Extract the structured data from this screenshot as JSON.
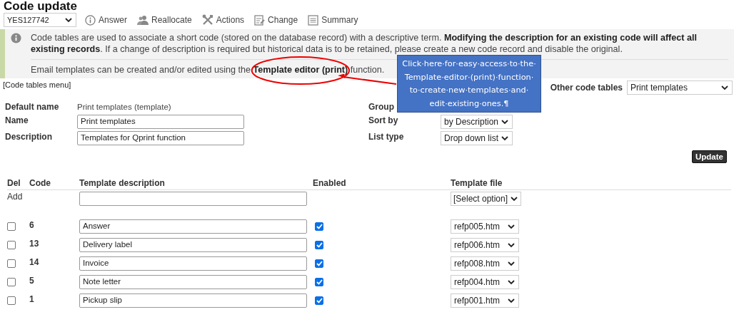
{
  "title": "Code update",
  "record_select": {
    "value": "YES127742"
  },
  "toolbar": [
    {
      "label": "Answer"
    },
    {
      "label": "Reallocate"
    },
    {
      "label": "Actions"
    },
    {
      "label": "Change"
    },
    {
      "label": "Summary"
    }
  ],
  "info": {
    "paragraphs": [
      "Code tables are used to associate a short code (stored on the database record) with a descriptive term. **Modifying the description for an existing code will affect all existing records**. If a change of description is required but historical data is to be retained, please create a new code record and disable the original.",
      "Email templates can be created and/or edited using the **Template editor (print)** function."
    ]
  },
  "code_tables_menu": "[Code tables menu]",
  "other_code_tables": {
    "label": "Other code tables",
    "value": "Print templates"
  },
  "form": {
    "left": [
      {
        "label": "Default name",
        "kind": "text",
        "value": "Print templates (template)"
      },
      {
        "label": "Name",
        "kind": "input",
        "value": "Print templates"
      },
      {
        "label": "Description",
        "kind": "input",
        "value": "Templates for Qprint function"
      }
    ],
    "right": [
      {
        "label": "Group",
        "kind": "none"
      },
      {
        "label": "Sort by",
        "kind": "select",
        "value": "by Description"
      },
      {
        "label": "List type",
        "kind": "select",
        "value": "Drop down list"
      }
    ]
  },
  "update_button": "Update",
  "table": {
    "columns": [
      "Del",
      "Code",
      "Template description",
      "Enabled",
      "Template file"
    ],
    "add_row": {
      "label": "Add",
      "file": "[Select option]"
    },
    "rows": [
      {
        "delete": false,
        "code": "6",
        "description": "Answer",
        "enabled": true,
        "file": "refp005.htm"
      },
      {
        "delete": false,
        "code": "13",
        "description": "Delivery label",
        "enabled": true,
        "file": "refp006.htm"
      },
      {
        "delete": false,
        "code": "14",
        "description": "Invoice",
        "enabled": true,
        "file": "refp008.htm"
      },
      {
        "delete": false,
        "code": "5",
        "description": "Note letter",
        "enabled": true,
        "file": "refp004.htm"
      },
      {
        "delete": false,
        "code": "1",
        "description": "Pickup slip",
        "enabled": true,
        "file": "refp001.htm"
      }
    ]
  },
  "callout": {
    "text": "Click·here·for·easy·access·to·the·Template·editor·(print)·function·to·create·new·templates·and·edit·existing·ones.¶"
  }
}
